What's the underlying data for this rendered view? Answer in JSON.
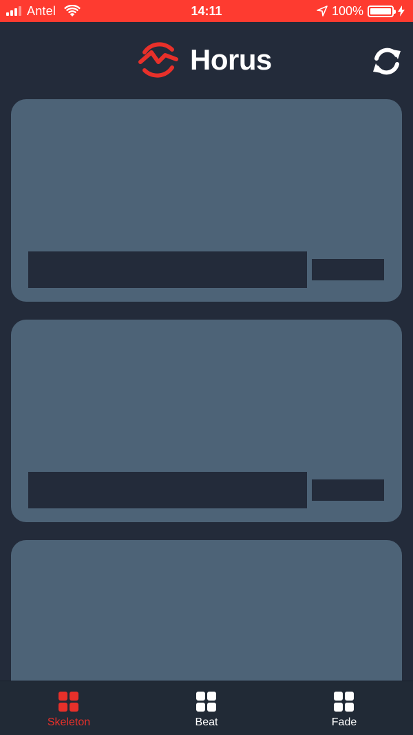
{
  "status_bar": {
    "carrier": "Antel",
    "time": "14:11",
    "battery": "100%"
  },
  "header": {
    "brand": "Horus",
    "logo_color": "#e8302a"
  },
  "cards": [
    {
      "state": "loading-skeleton"
    },
    {
      "state": "loading-skeleton"
    },
    {
      "state": "loading-skeleton"
    }
  ],
  "tab_bar": {
    "active_color": "#e8302a",
    "items": [
      {
        "label": "Skeleton",
        "icon": "grid-icon",
        "active": true
      },
      {
        "label": "Beat",
        "icon": "grid-icon",
        "active": false
      },
      {
        "label": "Fade",
        "icon": "grid-icon",
        "active": false
      }
    ]
  }
}
